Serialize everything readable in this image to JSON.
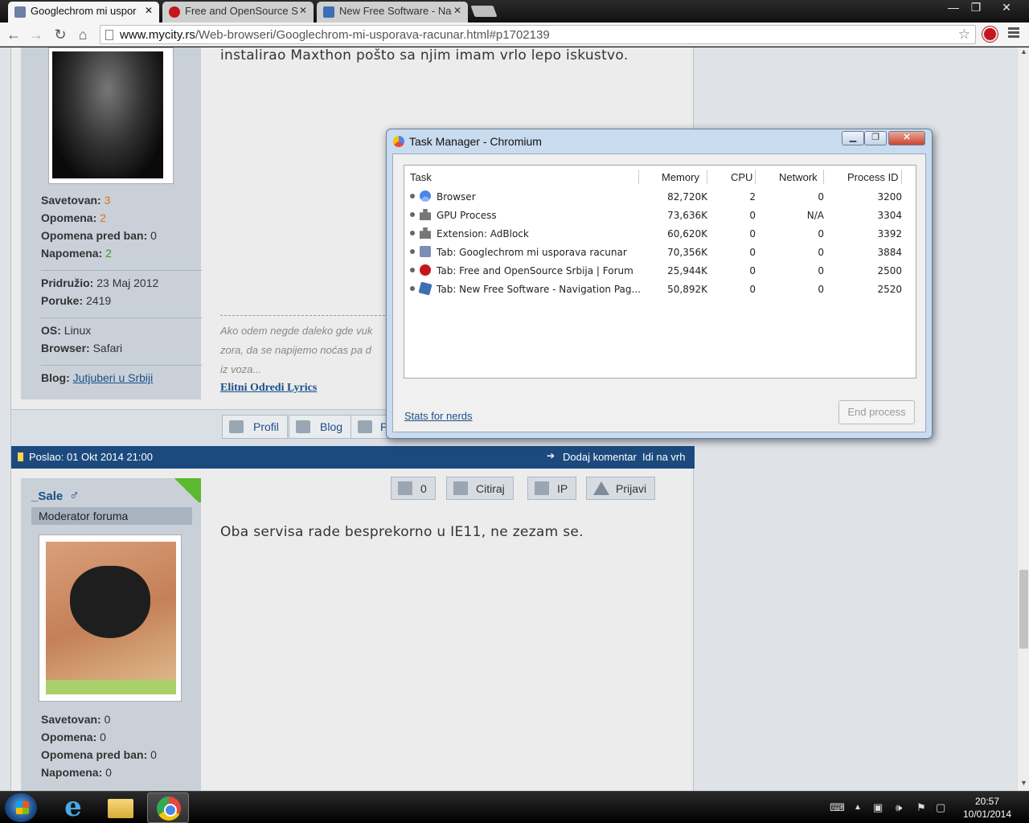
{
  "browser": {
    "tabs": [
      {
        "title": "Googlechrom mi uspor",
        "active": true
      },
      {
        "title": "Free and OpenSource S"
      },
      {
        "title": "New Free Software - Na"
      }
    ],
    "url_host": "www.mycity.rs",
    "url_path": "/Web-browseri/Googlechrom-mi-usporava-racunar.html#p1702139",
    "window_controls": {
      "minimize": "—",
      "maximize": "❐",
      "close": "✕"
    }
  },
  "forum": {
    "post1": {
      "text": "instalirao Maxthon pošto sa njim imam vrlo lepo iskustvo.",
      "author_stats": {
        "savetovan_label": "Savetovan:",
        "savetovan_value": "3",
        "opomena_label": "Opomena:",
        "opomena_value": "2",
        "opomena_ban_label": "Opomena pred ban:",
        "opomena_ban_value": "0",
        "napomena_label": "Napomena:",
        "napomena_value": "2",
        "pridruzio_label": "Pridružio:",
        "pridruzio_value": "23 Maj 2012",
        "poruke_label": "Poruke:",
        "poruke_value": "2419",
        "os_label": "OS:",
        "os_value": "Linux",
        "browser_label": "Browser:",
        "browser_value": "Safari",
        "blog_label": "Blog:",
        "blog_value": "Jutjuberi u Srbiji"
      },
      "signature_lines": [
        "Ako odem negde daleko gde vuk",
        "zora, da se napijemo noćas pa d",
        "iz voza..."
      ],
      "signature_link": "Elitni Odredi Lyrics",
      "profile_buttons": [
        "Profil",
        "Blog",
        "P"
      ]
    },
    "post2": {
      "header_date": "Poslao: 01 Okt 2014 21:00",
      "add_comment": "Dodaj komentar",
      "go_top": "Idi na vrh",
      "username": "_Sale",
      "gender_symbol": "♂",
      "rank": "Moderator foruma",
      "action_buttons": {
        "like_count": "0",
        "quote": "Citiraj",
        "ip": "IP",
        "report": "Prijavi"
      },
      "text": "Oba servisa rade besprekorno u IE11, ne zezam se.",
      "author_stats": {
        "savetovan_label": "Savetovan:",
        "savetovan_value": "0",
        "opomena_label": "Opomena:",
        "opomena_value": "0",
        "opomena_ban_label": "Opomena pred ban:",
        "opomena_ban_value": "0",
        "napomena_label": "Napomena:",
        "napomena_value": "0"
      }
    }
  },
  "task_manager": {
    "title": "Task Manager - Chromium",
    "columns": [
      "Task",
      "Memory",
      "CPU",
      "Network",
      "Process ID"
    ],
    "rows": [
      {
        "icon": "chromium-icon",
        "task": "Browser",
        "memory": "82,720K",
        "cpu": "2",
        "network": "0",
        "pid": "3200"
      },
      {
        "icon": "puzzle-icon",
        "task": "GPU Process",
        "memory": "73,636K",
        "cpu": "0",
        "network": "N/A",
        "pid": "3304"
      },
      {
        "icon": "puzzle-icon",
        "task": "Extension: AdBlock",
        "memory": "60,620K",
        "cpu": "0",
        "network": "0",
        "pid": "3392"
      },
      {
        "icon": "mycity-icon",
        "task": "Tab: Googlechrom mi usporava racunar",
        "memory": "70,356K",
        "cpu": "0",
        "network": "0",
        "pid": "3884"
      },
      {
        "icon": "stop-icon",
        "task": "Tab: Free and OpenSource Srbija | Forum",
        "memory": "25,944K",
        "cpu": "0",
        "network": "0",
        "pid": "2500"
      },
      {
        "icon": "nfs-icon",
        "task": "Tab: New Free Software - Navigation Pag...",
        "memory": "50,892K",
        "cpu": "0",
        "network": "0",
        "pid": "2520"
      }
    ],
    "stats_link": "Stats for nerds",
    "end_process": "End process"
  },
  "taskbar": {
    "time": "20:57",
    "date": "10/01/2014"
  },
  "colors": {
    "post_header": "#1c4a7e",
    "link": "#1a4f8a",
    "orange_value": "#e86c1c",
    "green_value": "#3a9a1f"
  }
}
